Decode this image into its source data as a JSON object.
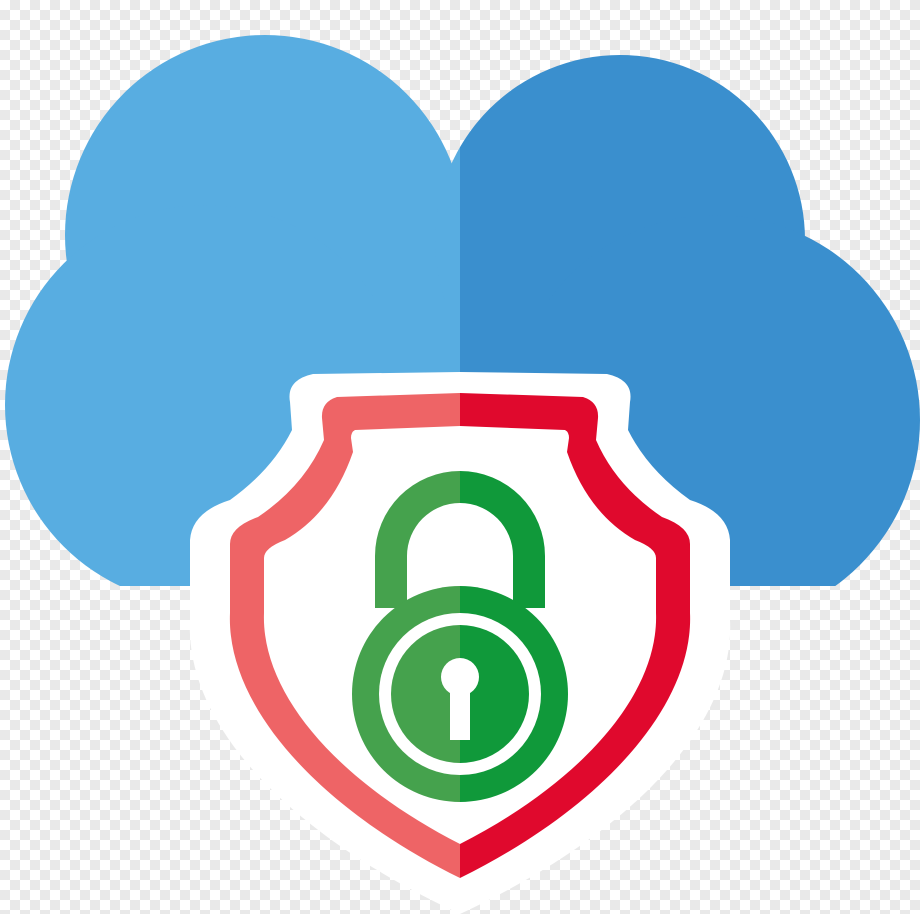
{
  "colors": {
    "transparency_checker_light": "#ffffff",
    "transparency_checker_dark": "#e9e9e9",
    "cloud_left": "#58ade1",
    "cloud_right": "#3a8fce",
    "shield_fill": "#ffffff",
    "shield_outline_left": "#ee6466",
    "shield_outline_right": "#e0092d",
    "lock_left": "#45a24d",
    "lock_right": "#10993a"
  },
  "icons": {
    "cloud": "cloud-icon",
    "shield": "shield-icon",
    "padlock": "padlock-icon",
    "keyhole": "keyhole-icon"
  }
}
